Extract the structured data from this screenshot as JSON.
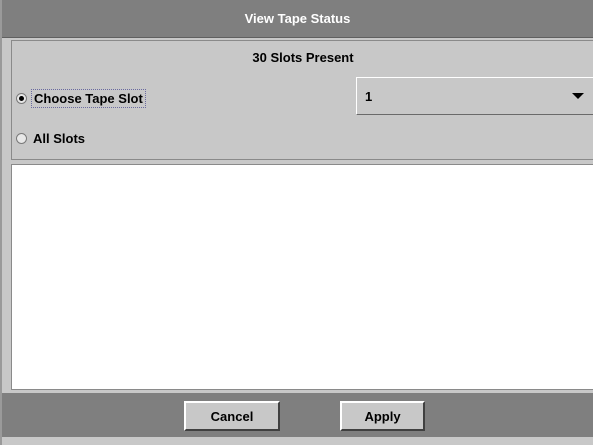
{
  "window": {
    "title": "View Tape Status"
  },
  "options": {
    "slots_present": "30 Slots Present",
    "radios": [
      {
        "label": "Choose Tape Slot",
        "selected": true
      },
      {
        "label": "All Slots",
        "selected": false
      }
    ],
    "slot_select": {
      "value": "1",
      "icon": "chevron-down-icon"
    }
  },
  "status": {
    "content": ""
  },
  "buttons": {
    "cancel_label": "Cancel",
    "apply_label": "Apply"
  },
  "colors": {
    "title_bg": "#7f7f7f",
    "panel_bg": "#c8c8c8",
    "content_bg": "#ffffff"
  }
}
